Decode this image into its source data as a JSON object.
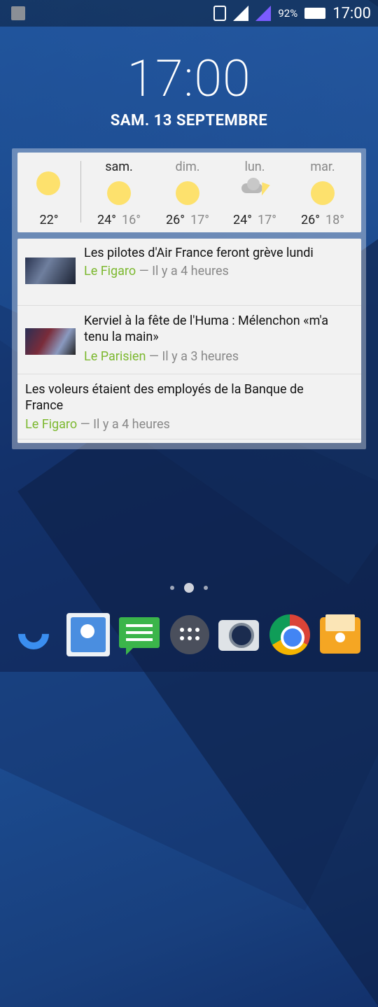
{
  "statusbar": {
    "battery": "92%",
    "time": "17:00",
    "signal_color": "#7b5cff"
  },
  "lockscreen": {
    "clock": "17:00",
    "date": "SAM. 13 SEPTEMBRE"
  },
  "weather": {
    "today": {
      "temp": "22°"
    },
    "days": [
      {
        "name": "sam.",
        "hi": "24°",
        "lo": "16°",
        "icon": "sun-icon"
      },
      {
        "name": "dim.",
        "hi": "26°",
        "lo": "17°",
        "icon": "sun-icon"
      },
      {
        "name": "lun.",
        "hi": "24°",
        "lo": "17°",
        "icon": "storm-icon"
      },
      {
        "name": "mar.",
        "hi": "26°",
        "lo": "18°",
        "icon": "sun-icon"
      }
    ]
  },
  "news": [
    {
      "headline": "Les pilotes d'Air France feront grève lundi",
      "source": "Le Figaro",
      "age": "— Il y a 4 heures"
    },
    {
      "headline_line1": "Kerviel à la fête de l'Huma : Mélenchon «m'a",
      "headline_line2": "tenu la main»",
      "source": "Le Parisien",
      "age": "— Il y a 3 heures"
    },
    {
      "headline_line1": "Les voleurs étaient des employés de la Banque de",
      "headline_line2": "France",
      "source": "Le Figaro",
      "age": "— Il y a 4 heures"
    }
  ],
  "dock": {
    "apps": [
      "phone-icon",
      "contacts-icon",
      "messages-icon",
      "app-drawer-icon",
      "camera-icon",
      "chrome-icon",
      "wallet-icon"
    ]
  }
}
